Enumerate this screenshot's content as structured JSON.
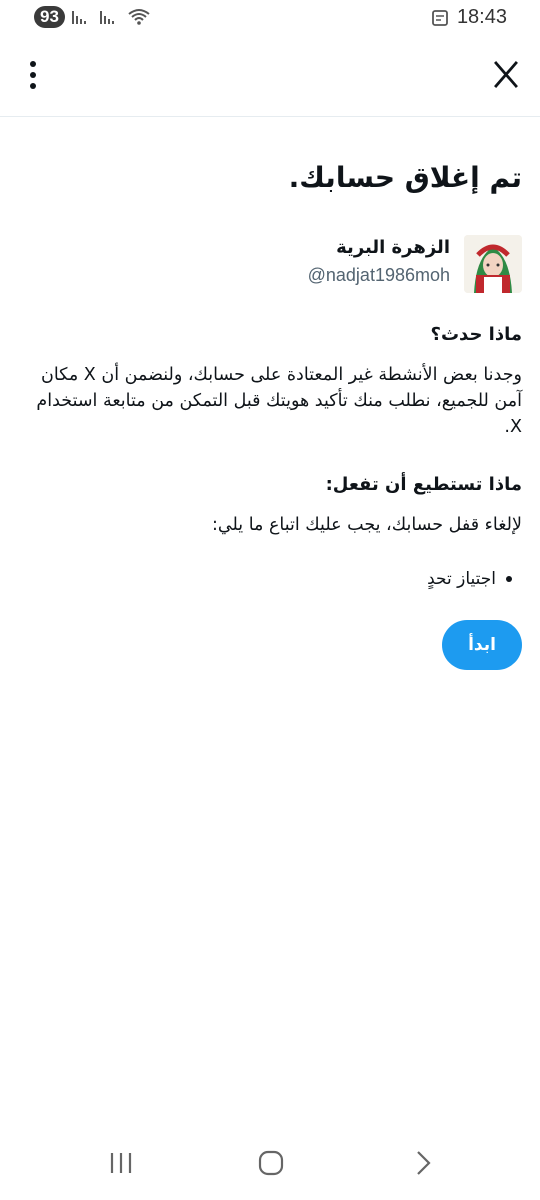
{
  "status_bar": {
    "battery": "93",
    "time": "18:43"
  },
  "top_bar": {
    "menu_icon": "more-vertical-icon",
    "logo_icon": "x-logo-icon"
  },
  "content": {
    "title": "تم إغلاق حسابك.",
    "user": {
      "display_name": "الزهرة البرية",
      "handle": "@nadjat1986moh"
    },
    "what_happened": {
      "heading": "ماذا حدث؟",
      "body": "وجدنا بعض الأنشطة غير المعتادة على حسابك، ولنضمن أن X مكان آمن للجميع، نطلب منك تأكيد هويتك قبل التمكن من متابعة استخدام X."
    },
    "what_you_can_do": {
      "heading": "ماذا تستطيع أن تفعل:",
      "body": "لإلغاء قفل حسابك، يجب عليك اتباع ما يلي:",
      "steps": [
        "اجتياز تحدٍ"
      ]
    },
    "start_button": "ابدأ"
  },
  "colors": {
    "accent": "#1d9bf0",
    "text": "#0f1419",
    "muted": "#536471"
  }
}
